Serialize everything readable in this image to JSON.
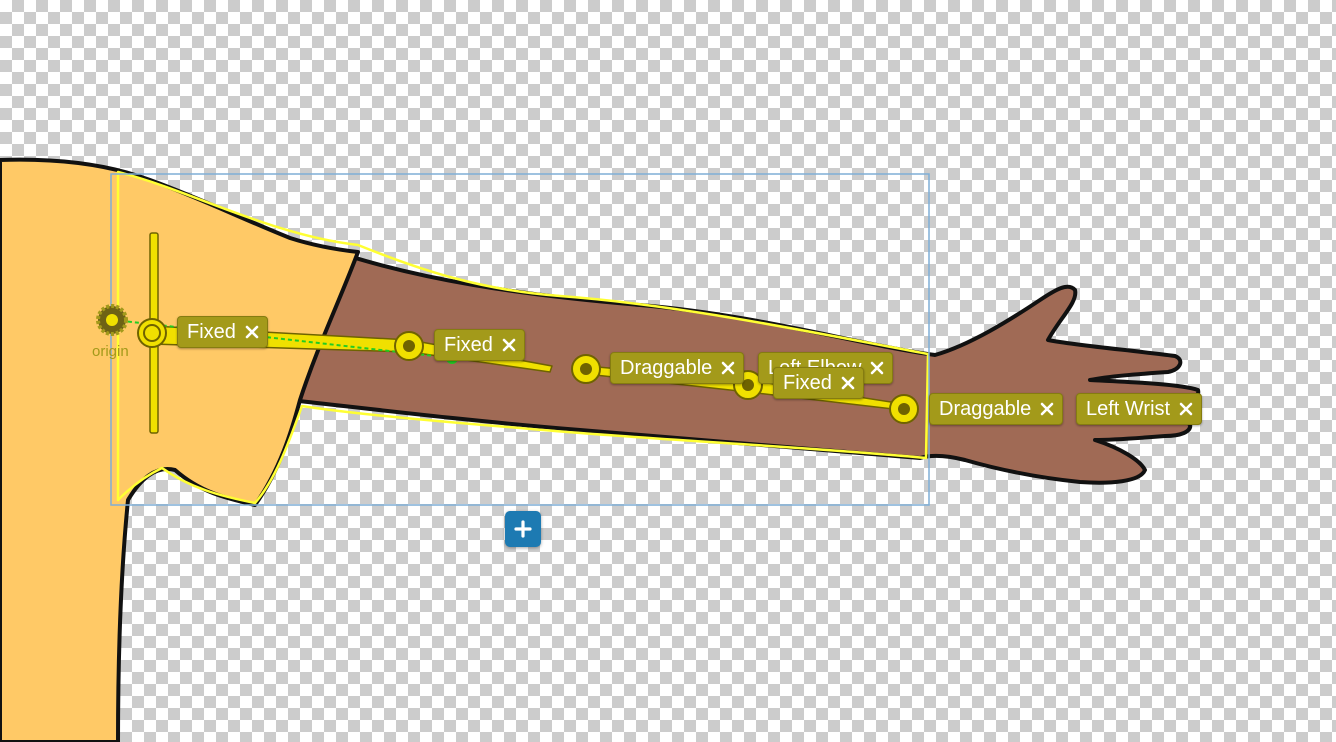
{
  "origin": {
    "label": "origin"
  },
  "tags": [
    {
      "label": "Fixed"
    },
    {
      "label": "Fixed"
    },
    {
      "label": "Draggable"
    },
    {
      "label": "Left Elbow"
    },
    {
      "label": "Fixed"
    },
    {
      "label": "Draggable"
    },
    {
      "label": "Left Wrist"
    }
  ],
  "icons": {
    "tag_close": "close-icon",
    "add": "plus-icon",
    "handle": "handle-icon",
    "origin": "origin-icon"
  },
  "colors": {
    "tag_background": "#a39a1a",
    "handle": "#f0e000",
    "outline": "#ffff33",
    "bounding_box": "#7faed6",
    "path_line": "#22cc22",
    "add_button": "#1d7ab2",
    "sleeve": "#ffc966",
    "skin": "#a06a55"
  }
}
